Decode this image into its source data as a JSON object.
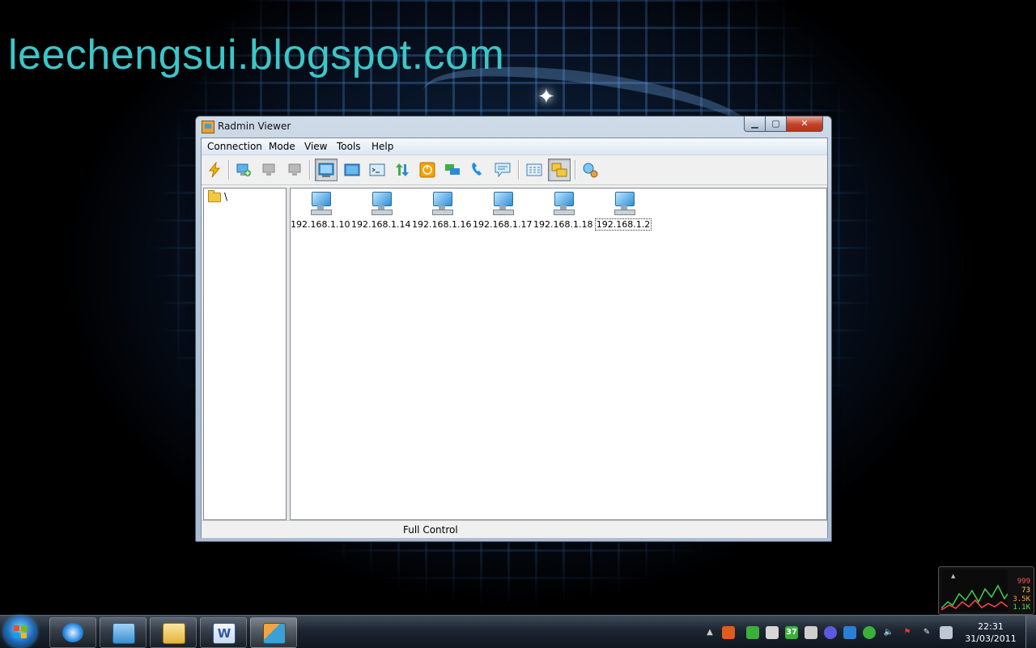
{
  "desktop": {
    "watermark": "leechengsui.blogspot.com"
  },
  "window": {
    "title": "Radmin Viewer",
    "menu": [
      "Connection",
      "Mode",
      "View",
      "Tools",
      "Help"
    ],
    "toolbar": [
      {
        "icon": "lightning-icon",
        "pressed": false
      },
      {
        "icon": "add-connection-icon",
        "pressed": false
      },
      {
        "icon": "disabled-computer-icon",
        "pressed": false
      },
      {
        "icon": "disabled-computer-icon",
        "pressed": false
      },
      {
        "icon": "full-control-mode-icon",
        "pressed": true
      },
      {
        "icon": "view-only-mode-icon",
        "pressed": false
      },
      {
        "icon": "telnet-icon",
        "pressed": false
      },
      {
        "icon": "file-transfer-icon",
        "pressed": false
      },
      {
        "icon": "shutdown-icon",
        "pressed": false
      },
      {
        "icon": "chat-icon",
        "pressed": false
      },
      {
        "icon": "voice-chat-icon",
        "pressed": false
      },
      {
        "icon": "send-message-icon",
        "pressed": false
      },
      {
        "icon": "list-view-icon",
        "pressed": false
      },
      {
        "icon": "large-icons-view-icon",
        "pressed": true
      },
      {
        "icon": "search-computers-icon",
        "pressed": false
      }
    ],
    "tree_root": "\\",
    "hosts": [
      "192.168.1.10",
      "192.168.1.14",
      "192.168.1.16",
      "192.168.1.17",
      "192.168.1.18",
      "192.168.1.2"
    ],
    "selected_host": "192.168.1.2",
    "status": "Full Control"
  },
  "gadget": {
    "values": [
      "999",
      "73",
      "3.5K",
      "1.1K"
    ],
    "colors": [
      "#ff5555",
      "#ffd84a",
      "#ff9c3a",
      "#50e050"
    ]
  },
  "taskbar": {
    "apps": [
      "internet-explorer-icon",
      "control-panel-icon",
      "windows-explorer-icon",
      "microsoft-word-icon",
      "radmin-viewer-icon"
    ],
    "active_app": "radmin-viewer-icon",
    "tray_badge": "37",
    "clock": {
      "time": "22:31",
      "date": "31/03/2011"
    }
  }
}
